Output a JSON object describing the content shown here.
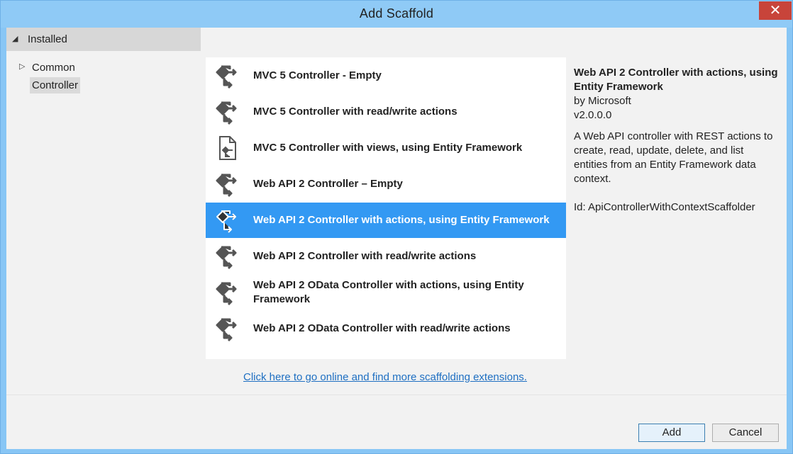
{
  "window": {
    "title": "Add Scaffold",
    "close_glyph": "✕"
  },
  "sidebar": {
    "installed_label": "Installed",
    "items": [
      {
        "label": "Common"
      },
      {
        "label": "Controller"
      }
    ]
  },
  "scaffolders": [
    {
      "label": "MVC 5 Controller - Empty",
      "icon": "controller-icon"
    },
    {
      "label": "MVC 5 Controller with read/write actions",
      "icon": "controller-icon"
    },
    {
      "label": "MVC 5 Controller with views, using Entity Framework",
      "icon": "controller-views-icon"
    },
    {
      "label": "Web API 2 Controller – Empty",
      "icon": "controller-icon"
    },
    {
      "label": "Web API 2 Controller with actions, using Entity Framework",
      "icon": "controller-icon",
      "selected": true
    },
    {
      "label": "Web API 2 Controller with read/write actions",
      "icon": "controller-icon"
    },
    {
      "label": "Web API 2 OData Controller with actions, using Entity Framework",
      "icon": "controller-icon"
    },
    {
      "label": "Web API 2 OData Controller with read/write actions",
      "icon": "controller-icon"
    }
  ],
  "details": {
    "title": "Web API 2 Controller with actions, using Entity Framework",
    "author": "by Microsoft",
    "version": "v2.0.0.0",
    "description": "A Web API controller with REST actions to create, read, update, delete, and list entities from an Entity Framework data context.",
    "id": "Id: ApiControllerWithContextScaffolder"
  },
  "online_link": "Click here to go online and find more scaffolding extensions.",
  "buttons": {
    "add": "Add",
    "cancel": "Cancel"
  },
  "colors": {
    "selection": "#3399f3",
    "titlebar": "#8fcaf6",
    "close": "#c8443a",
    "link": "#1e6fc2"
  }
}
